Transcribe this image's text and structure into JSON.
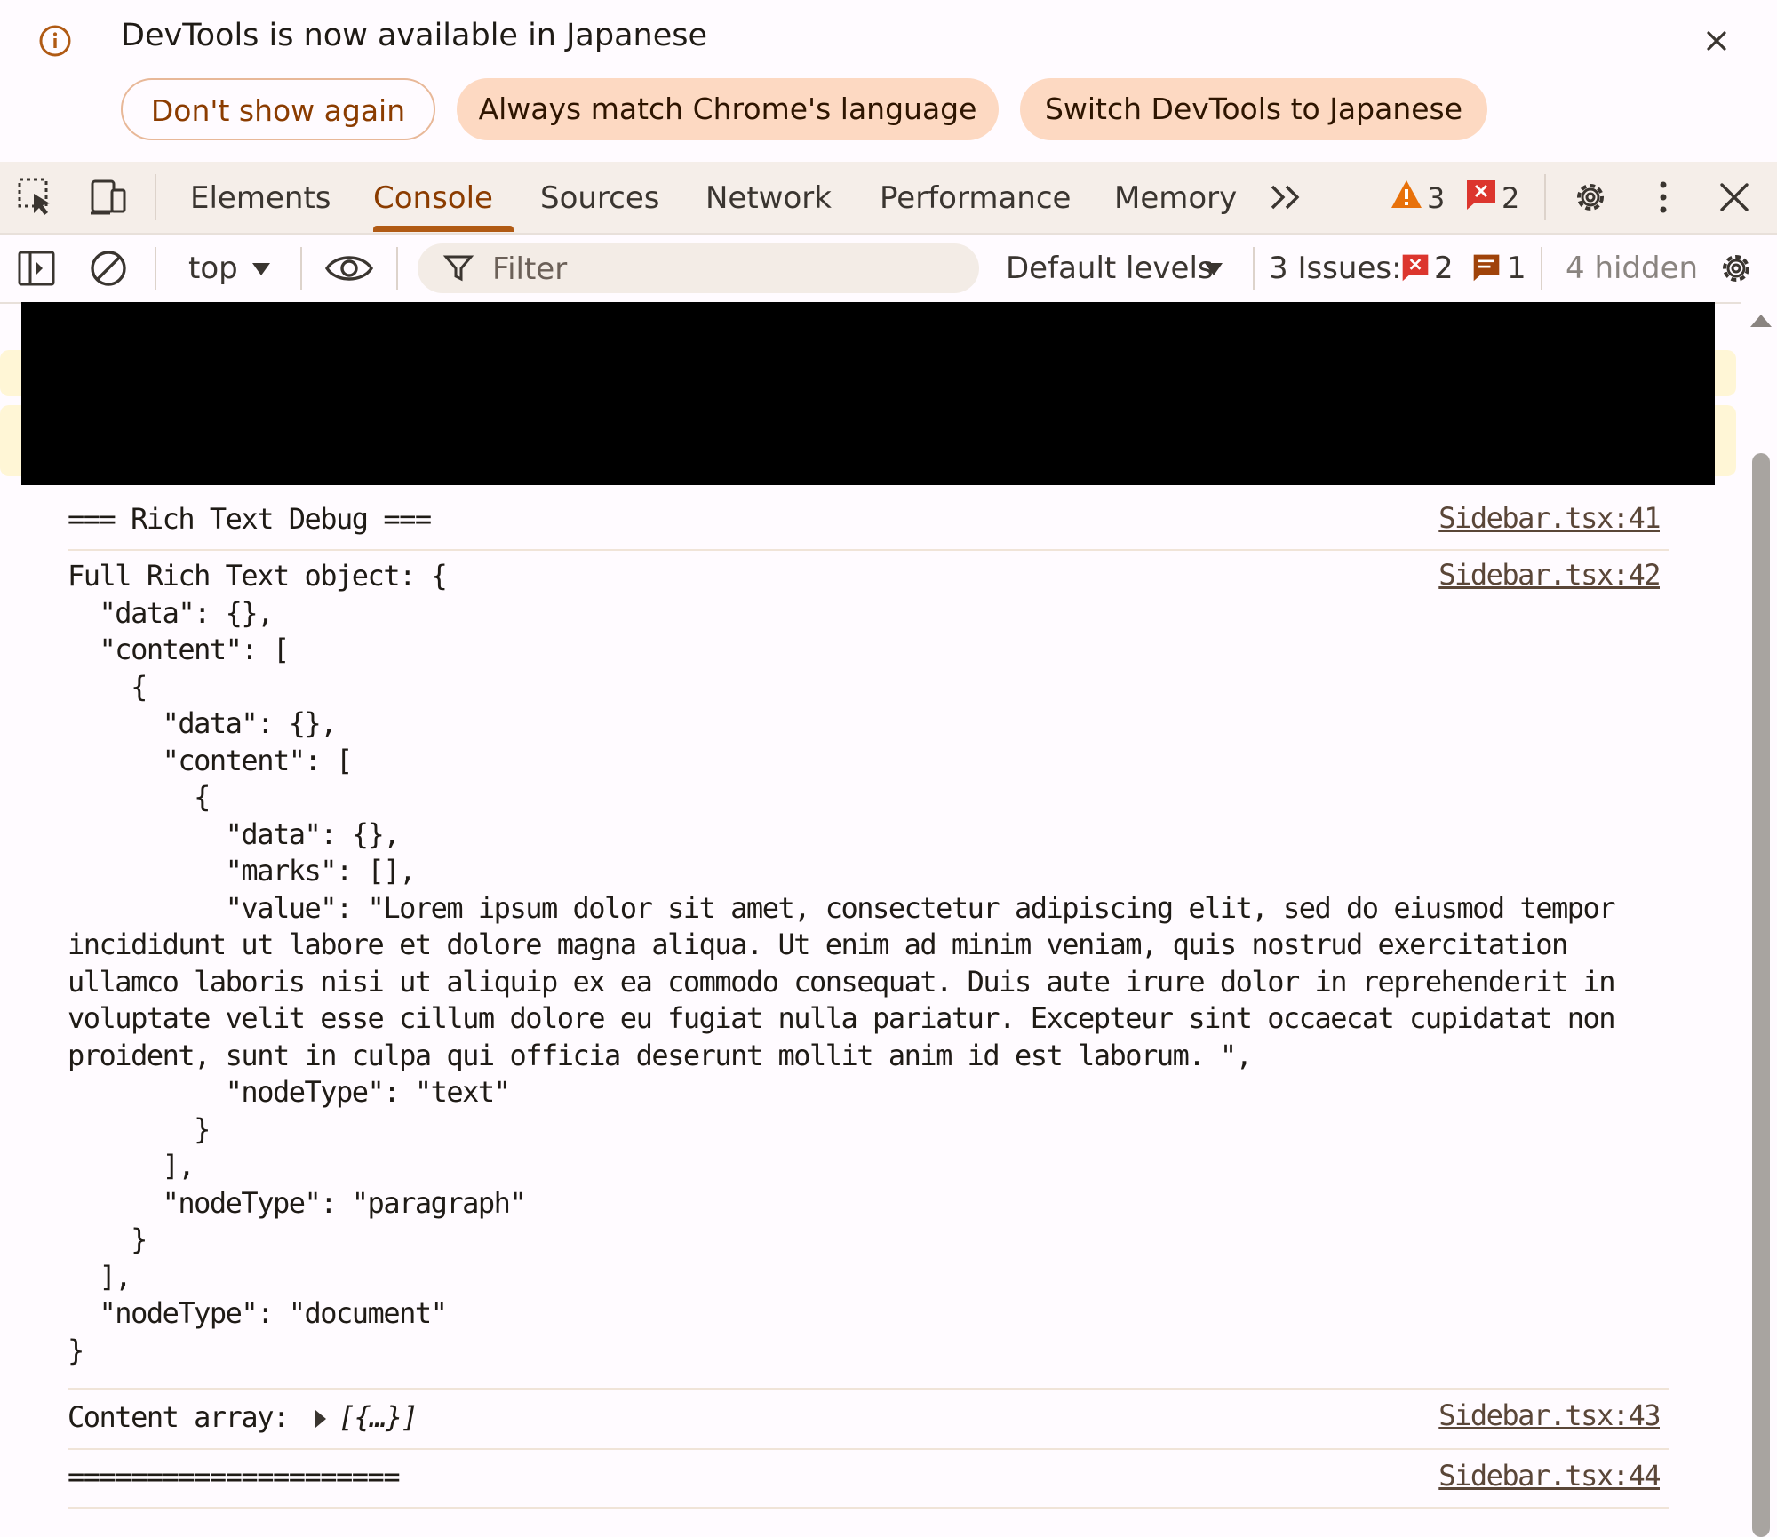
{
  "infobar": {
    "message": "DevTools is now available in Japanese",
    "buttons": {
      "dont_show": "Don't show again",
      "always_match": "Always match Chrome's language",
      "switch": "Switch DevTools to Japanese"
    }
  },
  "tabs": [
    {
      "label": "Elements"
    },
    {
      "label": "Console"
    },
    {
      "label": "Sources"
    },
    {
      "label": "Network"
    },
    {
      "label": "Performance"
    },
    {
      "label": "Memory"
    }
  ],
  "active_tab": "Console",
  "tab_badges": {
    "warnings": "3",
    "errors": "2"
  },
  "console_toolbar": {
    "context": "top",
    "filter_placeholder": "Filter",
    "levels": "Default levels",
    "issues_label": "3 Issues:",
    "issues_errors": "2",
    "issues_info": "1",
    "hidden": "4 hidden"
  },
  "messages": [
    {
      "text": "=== Rich Text Debug ===",
      "source": "Sidebar.tsx:41"
    },
    {
      "text": "Full Rich Text object: {\n  \"data\": {},\n  \"content\": [\n    {\n      \"data\": {},\n      \"content\": [\n        {\n          \"data\": {},\n          \"marks\": [],\n          \"value\": \"Lorem ipsum dolor sit amet, consectetur adipiscing elit, sed do eiusmod tempor\nincididunt ut labore et dolore magna aliqua. Ut enim ad minim veniam, quis nostrud exercitation\nullamco laboris nisi ut aliquip ex ea commodo consequat. Duis aute irure dolor in reprehenderit in\nvoluptate velit esse cillum dolore eu fugiat nulla pariatur. Excepteur sint occaecat cupidatat non\nproident, sunt in culpa qui officia deserunt mollit anim id est laborum. \",\n          \"nodeType\": \"text\"\n        }\n      ],\n      \"nodeType\": \"paragraph\"\n    }\n  ],\n  \"nodeType\": \"document\"\n}",
      "source": "Sidebar.tsx:42"
    },
    {
      "label": "Content array:",
      "preview": "[{…}]",
      "source": "Sidebar.tsx:43"
    },
    {
      "text": "=====================",
      "source": "Sidebar.tsx:44"
    }
  ],
  "colors": {
    "accent": "#8b3c00",
    "error": "#dc362e",
    "warning": "#e8710a"
  },
  "icons": [
    "info-icon",
    "close-icon",
    "inspect-element-icon",
    "device-toolbar-icon",
    "more-tabs-icon",
    "warning-icon",
    "error-icon",
    "settings-gear-icon",
    "kebab-menu-icon",
    "sidebar-toggle-icon",
    "clear-console-icon",
    "dropdown-arrow-icon",
    "eye-icon",
    "filter-funnel-icon",
    "issue-info-icon"
  ]
}
